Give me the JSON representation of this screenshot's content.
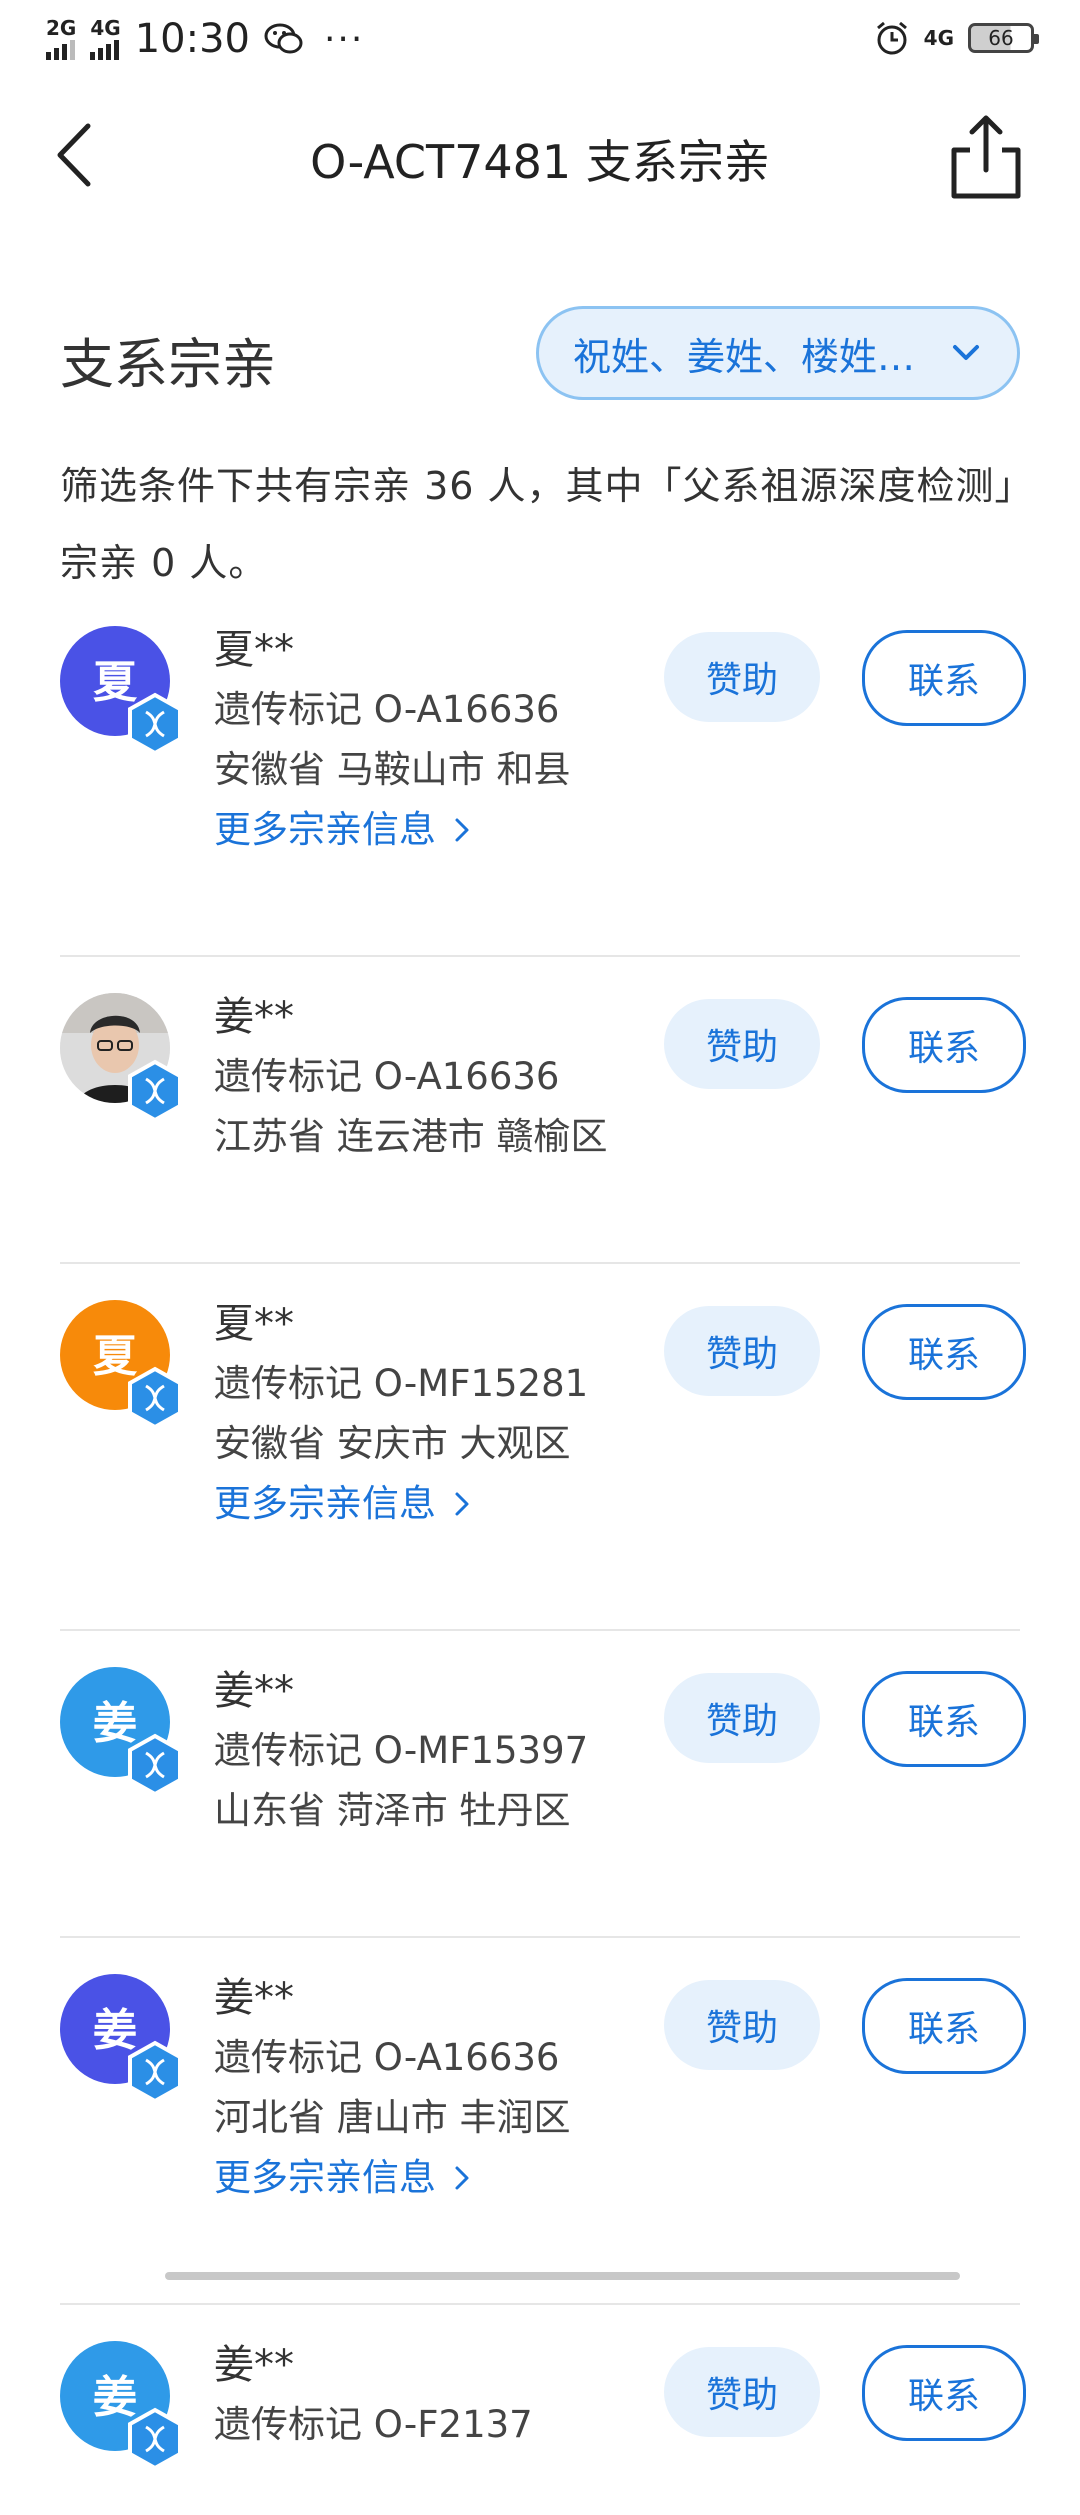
{
  "status_bar": {
    "net1": "2G",
    "net2": "4G",
    "time": "10:30",
    "dots": "···",
    "net_right": "4G",
    "battery": "66"
  },
  "nav": {
    "title": "O-ACT7481 支系宗亲"
  },
  "section": {
    "title": "支系宗亲",
    "filter": "祝姓、姜姓、楼姓…"
  },
  "summary": "筛选条件下共有宗亲 36 人，其中「父系祖源深度检测」宗亲 0 人。",
  "labels": {
    "sponsor": "赞助",
    "contact": "联系",
    "more": "更多宗亲信息"
  },
  "colors": {
    "accent": "#1a73d9",
    "avatar_purple": "#4a52e6",
    "avatar_orange": "#f78a0a",
    "avatar_blue": "#2f9ae8"
  },
  "relatives": [
    {
      "avatar_char": "夏",
      "avatar_color": "#4a52e6",
      "name": "夏**",
      "marker": "遗传标记 O-A16636",
      "location": "安徽省 马鞍山市 和县",
      "has_more": true
    },
    {
      "avatar_char": "",
      "avatar_color": "photo",
      "name": "姜**",
      "marker": "遗传标记 O-A16636",
      "location": "江苏省 连云港市 赣榆区",
      "has_more": false
    },
    {
      "avatar_char": "夏",
      "avatar_color": "#f78a0a",
      "name": "夏**",
      "marker": "遗传标记 O-MF15281",
      "location": "安徽省 安庆市 大观区",
      "has_more": true
    },
    {
      "avatar_char": "姜",
      "avatar_color": "#2f9ae8",
      "name": "姜**",
      "marker": "遗传标记 O-MF15397",
      "location": "山东省 菏泽市 牡丹区",
      "has_more": false
    },
    {
      "avatar_char": "姜",
      "avatar_color": "#4a52e6",
      "name": "姜**",
      "marker": "遗传标记 O-A16636",
      "location": "河北省 唐山市 丰润区",
      "has_more": true
    },
    {
      "avatar_char": "姜",
      "avatar_color": "#2f9ae8",
      "name": "姜**",
      "marker": "遗传标记 O-F2137",
      "location": "",
      "has_more": false
    }
  ]
}
